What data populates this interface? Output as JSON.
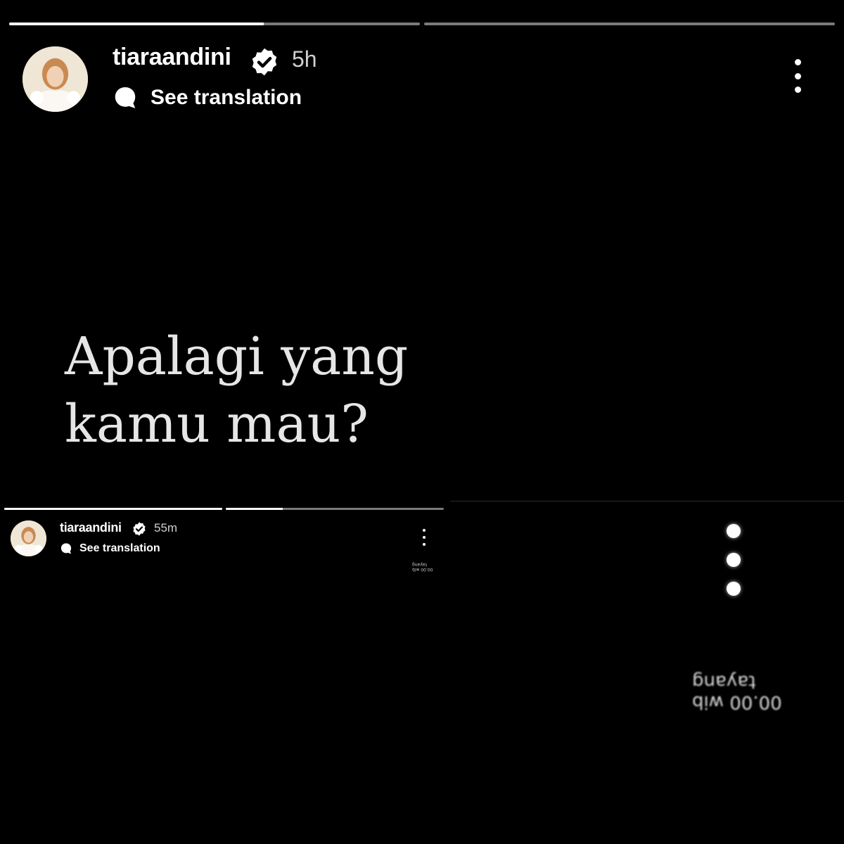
{
  "top_story": {
    "username": "tiaraandini",
    "time": "5h",
    "see_translation": "See translation",
    "text_line1": "Apalagi yang",
    "text_line2": "kamu mau?",
    "progress": [
      0.62,
      0.0
    ]
  },
  "bottom_left_story": {
    "username": "tiaraandini",
    "time": "55m",
    "see_translation": "See translation",
    "mirrored_line1": "00.00 wib",
    "mirrored_line2": "tayang",
    "progress": [
      1.0,
      0.26
    ]
  },
  "bottom_right_zoom": {
    "mirrored_line1": "00.00 wib",
    "mirrored_line2": "tayang"
  },
  "icons": {
    "verified": "verified-badge-icon",
    "translate": "speech-bubble-icon",
    "more": "more-vertical-icon"
  },
  "colors": {
    "background": "#000000",
    "bar_track": "#7a7a7a",
    "bar_fill": "#ffffff"
  }
}
